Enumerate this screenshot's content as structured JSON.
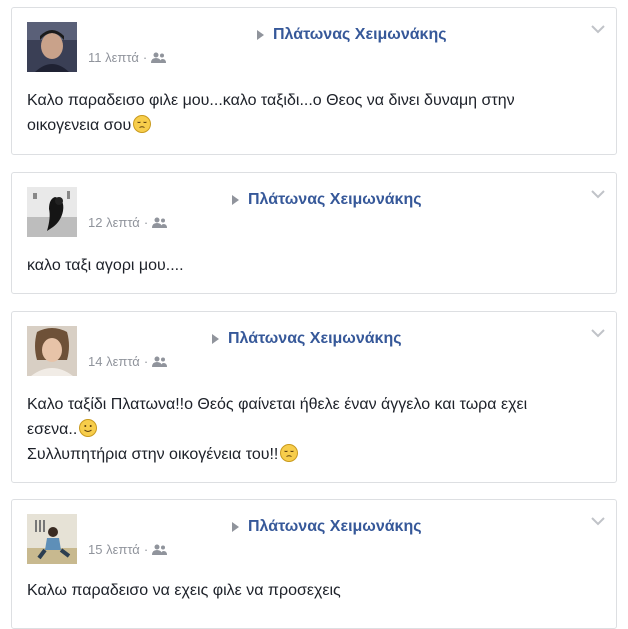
{
  "colors": {
    "link": "#365899",
    "meta": "#90949c",
    "text": "#1d2129",
    "border": "#dddfe2"
  },
  "posts": [
    {
      "time": "11 λεπτά",
      "target_name": "Πλάτωνας Χειμωνάκης",
      "lines": [
        "Καλο παραδεισο φιλε μου...καλο ταξιδι...ο Θεος να δινει δυναμη στην",
        "οικογενεια σου"
      ],
      "emoji": "pensive-face"
    },
    {
      "time": "12 λεπτά",
      "target_name": "Πλάτωνας Χειμωνάκης",
      "lines": [
        "καλο ταξι αγορι μου...."
      ]
    },
    {
      "time": "14 λεπτά",
      "target_name": "Πλάτωνας Χειμωνάκης",
      "lines": [
        "Καλο ταξίδι Πλατωνα!!ο Θεός φαίνεται ήθελε έναν άγγελο και τωρα εχει",
        "εσενα..",
        "Συλλυπητήρια στην οικογένεια του!!"
      ],
      "emojis": [
        "slight-smile-face",
        "pensive-face"
      ]
    },
    {
      "time": "15 λεπτά",
      "target_name": "Πλάτωνας Χειμωνάκης",
      "lines": [
        "Καλω παραδεισο να εχεις φιλε να προσεχεις"
      ]
    }
  ],
  "meta_separator": "·",
  "icons": {
    "audience": "friends-audience-icon",
    "menu": "chevron-down-icon",
    "target_arrow": "triangle-right-icon"
  }
}
